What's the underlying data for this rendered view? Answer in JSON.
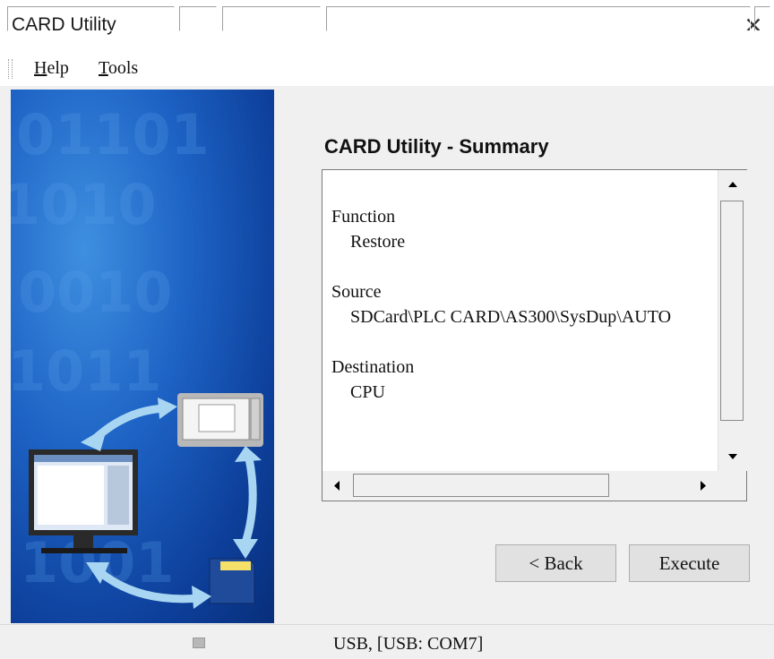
{
  "window": {
    "title": "CARD Utility",
    "close_glyph": "✕"
  },
  "menu": [
    {
      "key": "H",
      "rest": "elp"
    },
    {
      "key": "T",
      "rest": "ools"
    }
  ],
  "main": {
    "heading": "CARD Utility - Summary",
    "summary": [
      {
        "label": "Function",
        "value": "Restore"
      },
      {
        "label": "Source",
        "value": "SDCard\\PLC CARD\\AS300\\SysDup\\AUTO"
      },
      {
        "label": "Destination",
        "value": "CPU"
      }
    ],
    "buttons": {
      "back": "< Back",
      "execute": "Execute"
    }
  },
  "status": {
    "connection": "USB, [USB: COM7]"
  },
  "colors": {
    "banner": "#1d62c4",
    "arrow": "#a8d6f2",
    "button_face": "#e1e1e1",
    "frame": "#f0f0f0"
  },
  "icons": [
    "close-icon",
    "pc-monitor-icon",
    "plc-device-icon",
    "sd-card-icon",
    "sync-arrows-icon"
  ]
}
